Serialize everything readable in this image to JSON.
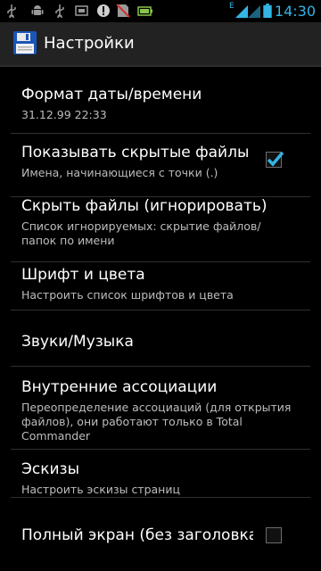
{
  "status_bar": {
    "time": "14:30",
    "icons": [
      "usb-icon",
      "android-debug-icon",
      "usb-icon",
      "screenshot-icon",
      "info-icon",
      "no-sim-icon",
      "battery-full-icon",
      "network-e-icon",
      "signal-icon",
      "battery-icon"
    ],
    "network_label": "E",
    "accent_color": "#33b5e5"
  },
  "action_bar": {
    "title": "Настройки",
    "icon": "floppy-disk-icon"
  },
  "preferences": [
    {
      "title": "Формат даты/времени",
      "summary": "31.12.99  22:33"
    },
    {
      "title": "Показывать скрытые файлы",
      "summary": "Имена, начинающиеся с точки (.)",
      "checked": true
    },
    {
      "title": "Скрыть файлы (игнорировать)",
      "summary": "Список игнорируемых: скрытие файлов/ папок по имени"
    },
    {
      "title": "Шрифт и цвета",
      "summary": "Настроить список шрифтов и цвета"
    },
    {
      "title": "Звуки/Музыка"
    },
    {
      "title": "Внутренние ассоциации",
      "summary": "Переопределение ассоциаций (для открытия файлов), они работают только в Total Commander"
    },
    {
      "title": "Эскизы",
      "summary": "Настроить эскизы страниц"
    },
    {
      "title": "Полный экран (без заголовка",
      "checked": false
    }
  ]
}
